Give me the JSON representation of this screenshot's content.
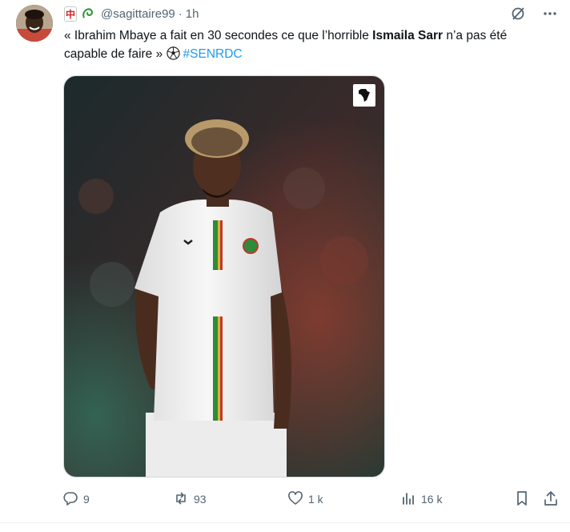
{
  "tweet": {
    "handle": "@sagittaire99",
    "separator": "·",
    "time": "1h",
    "text_part1": "« Ibrahim Mbaye a fait en 30 secondes ce que l’horrible ",
    "text_bold": "Ismaila Sarr",
    "text_part2": " n’a pas été capable de faire » ",
    "hashtag": "#SENRDC"
  },
  "actions": {
    "replies": "9",
    "reposts": "93",
    "likes": "1 k",
    "views": "16 k"
  },
  "colors": {
    "accent": "#1d9bf0",
    "secondary_text": "#536471",
    "primary_text": "#0f1419"
  },
  "icons": [
    "mahjong-emoji-icon",
    "scroll-emoji-icon",
    "grok-icon",
    "more-icon",
    "soccer-ball-icon",
    "africa-logo-icon",
    "reply-icon",
    "repost-icon",
    "like-icon",
    "views-icon",
    "bookmark-icon",
    "share-icon"
  ]
}
